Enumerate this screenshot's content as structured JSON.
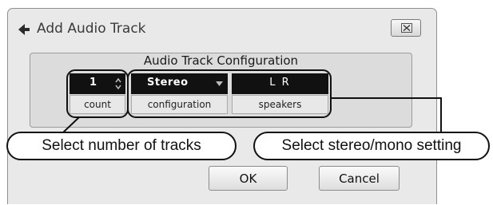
{
  "window": {
    "title": "Add Audio Track",
    "icon": "back-arrow-icon",
    "close_icon": "close-icon"
  },
  "config": {
    "title": "Audio Track Configuration",
    "count_value": "1",
    "count_label": "count",
    "configuration_value": "Stereo",
    "configuration_label": "configuration",
    "speakers_value": "L R",
    "speakers_label": "speakers"
  },
  "callouts": {
    "left": "Select number of tracks",
    "right": "Select stereo/mono setting"
  },
  "buttons": {
    "ok": "OK",
    "cancel": "Cancel"
  }
}
